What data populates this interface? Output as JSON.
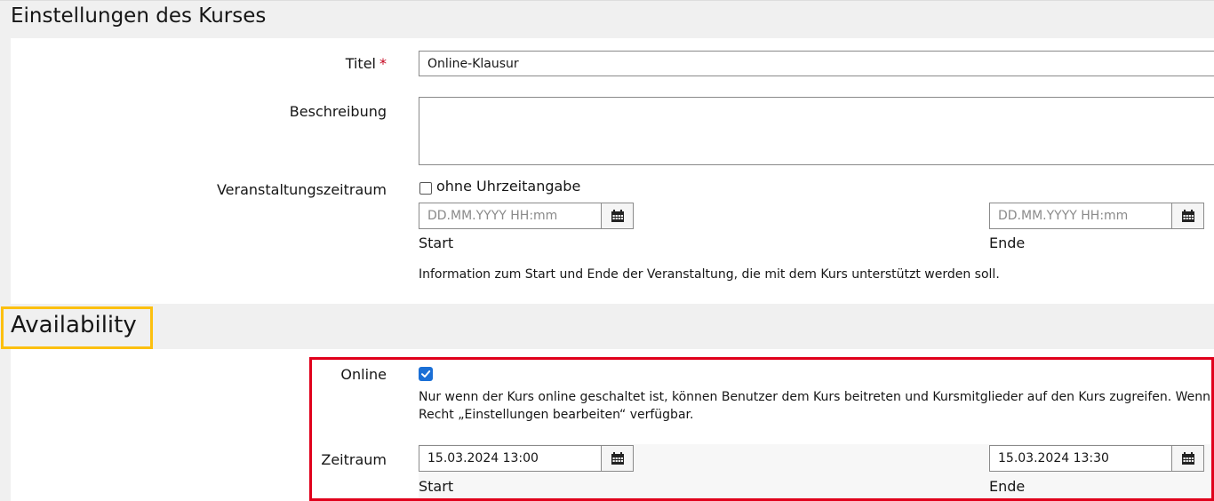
{
  "course_settings": {
    "section_title": "Einstellungen des Kurses",
    "title_field": {
      "label": "Titel",
      "required_marker": "*",
      "value": "Online-Klausur"
    },
    "description_field": {
      "label": "Beschreibung",
      "value": ""
    },
    "event_period": {
      "label": "Veranstaltungszeitraum",
      "no_time_checkbox_label": "ohne Uhrzeitangabe",
      "no_time_checked": false,
      "start": {
        "placeholder": "DD.MM.YYYY HH:mm",
        "value": "",
        "sublabel": "Start"
      },
      "end": {
        "placeholder": "DD.MM.YYYY HH:mm",
        "value": "",
        "sublabel": "Ende"
      },
      "help_text": "Information zum Start und Ende der Veranstaltung, die mit dem Kurs unterstützt werden soll."
    }
  },
  "availability": {
    "section_title": "Availability",
    "online": {
      "label": "Online",
      "checked": true,
      "help_line1": "Nur wenn der Kurs online geschaltet ist, können Benutzer dem Kurs beitreten und Kursmitglieder auf den Kurs zugreifen. Wenn nicht, ist",
      "help_line2": "Recht „Einstellungen bearbeiten“ verfügbar."
    },
    "period": {
      "label": "Zeitraum",
      "start": {
        "value": "15.03.2024 13:00",
        "sublabel": "Start"
      },
      "end": {
        "value": "15.03.2024 13:30",
        "sublabel": "Ende"
      }
    }
  },
  "colors": {
    "section_header_bg": "#f0f0f0",
    "required_marker": "#c4001a",
    "checkbox_checked": "#1a6fd6",
    "highlight_yellow": "#fcc010",
    "highlight_red": "#e0001b",
    "input_border": "#8a8a8a"
  },
  "icons": {
    "calendar_button": "calendar-icon",
    "checkmark": "checkmark-icon"
  }
}
